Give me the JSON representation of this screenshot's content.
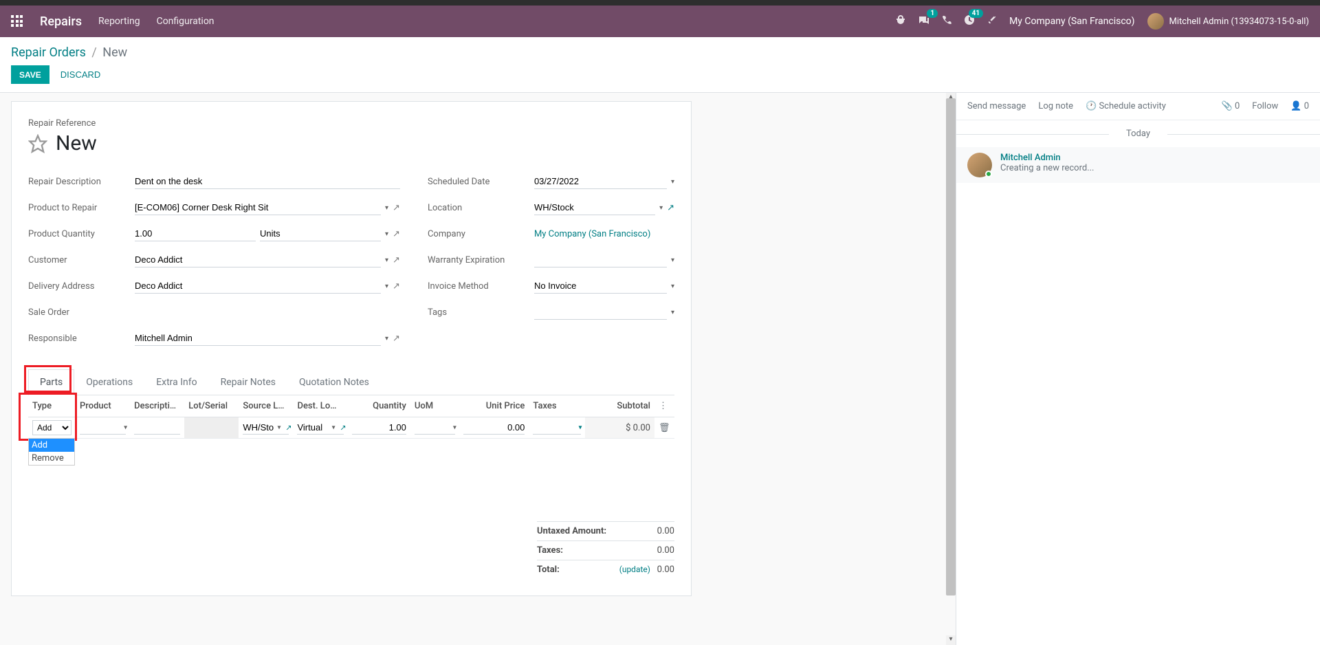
{
  "topbar": {
    "brand": "Repairs",
    "nav": [
      "Reporting",
      "Configuration"
    ],
    "badges": {
      "messages": "1",
      "activities": "41"
    },
    "company": "My Company (San Francisco)",
    "user": "Mitchell Admin (13934073-15-0-all)"
  },
  "breadcrumb": {
    "parent": "Repair Orders",
    "current": "New"
  },
  "buttons": {
    "save": "SAVE",
    "discard": "DISCARD"
  },
  "form": {
    "title_label": "Repair Reference",
    "title": "New",
    "left": {
      "repair_description": {
        "label": "Repair Description",
        "value": "Dent on the desk"
      },
      "product_to_repair": {
        "label": "Product to Repair",
        "value": "[E-COM06] Corner Desk Right Sit"
      },
      "product_quantity": {
        "label": "Product Quantity",
        "value": "1.00",
        "uom": "Units"
      },
      "customer": {
        "label": "Customer",
        "value": "Deco Addict"
      },
      "delivery_address": {
        "label": "Delivery Address",
        "value": "Deco Addict"
      },
      "sale_order": {
        "label": "Sale Order",
        "value": ""
      },
      "responsible": {
        "label": "Responsible",
        "value": "Mitchell Admin"
      }
    },
    "right": {
      "scheduled_date": {
        "label": "Scheduled Date",
        "value": "03/27/2022"
      },
      "location": {
        "label": "Location",
        "value": "WH/Stock"
      },
      "company": {
        "label": "Company",
        "value": "My Company (San Francisco)"
      },
      "warranty_expiration": {
        "label": "Warranty Expiration",
        "value": ""
      },
      "invoice_method": {
        "label": "Invoice Method",
        "value": "No Invoice"
      },
      "tags": {
        "label": "Tags",
        "value": ""
      }
    }
  },
  "tabs": [
    "Parts",
    "Operations",
    "Extra Info",
    "Repair Notes",
    "Quotation Notes"
  ],
  "parts": {
    "headers": [
      "Type",
      "Product",
      "Descripti…",
      "Lot/Serial",
      "Source L…",
      "Dest. Lo…",
      "Quantity",
      "UoM",
      "Unit Price",
      "Taxes",
      "Subtotal"
    ],
    "row": {
      "type": "Add",
      "product": "",
      "description": "",
      "lot_serial": "",
      "source": "WH/Sto",
      "dest": "Virtual",
      "quantity": "1.00",
      "uom": "",
      "unit_price": "0.00",
      "taxes": "",
      "subtotal": "$ 0.00"
    },
    "type_options": [
      "Add",
      "Remove"
    ]
  },
  "totals": {
    "untaxed_label": "Untaxed Amount:",
    "untaxed": "0.00",
    "taxes_label": "Taxes:",
    "taxes": "0.00",
    "total_label": "Total:",
    "update": "(update)",
    "total": "0.00"
  },
  "chatter": {
    "send_message": "Send message",
    "log_note": "Log note",
    "schedule_activity": "Schedule activity",
    "attach_count": "0",
    "follow": "Follow",
    "follower_count": "0",
    "divider": "Today",
    "message": {
      "author": "Mitchell Admin",
      "text": "Creating a new record..."
    }
  }
}
